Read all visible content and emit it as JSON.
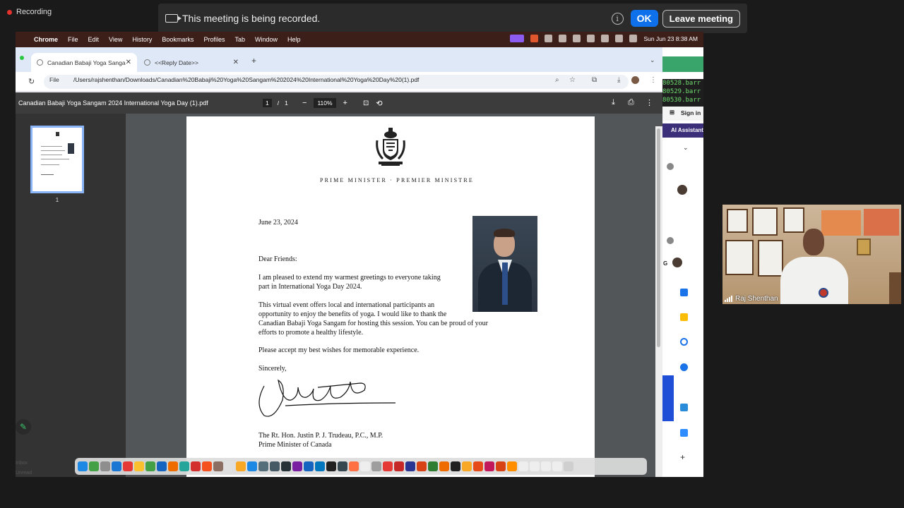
{
  "zoom": {
    "recording_label": "Recording",
    "banner_text": "This meeting is being recorded.",
    "ok_label": "OK",
    "leave_label": "Leave meeting",
    "participant_name": "Raj Shenthan"
  },
  "mac_menubar": {
    "app": "Chrome",
    "items": [
      "File",
      "Edit",
      "View",
      "History",
      "Bookmarks",
      "Profiles",
      "Tab",
      "Window",
      "Help"
    ],
    "clock": "Sun Jun 23  8:38 AM"
  },
  "browser": {
    "tabs": [
      {
        "label": "Canadian Babaji Yoga Sanga"
      },
      {
        "label": "<<Reply Date>>"
      }
    ],
    "url_scheme": "File",
    "url": "/Users/rajshenthan/Downloads/Canadian%20Babaji%20Yoga%20Sangam%202024%20International%20Yoga%20Day%20(1).pdf"
  },
  "pdf_viewer": {
    "title": "Canadian Babaji Yoga Sangam 2024 International Yoga Day (1).pdf",
    "page_current": "1",
    "page_sep": "/",
    "page_total": "1",
    "zoom": "110%",
    "thumb_page": "1"
  },
  "letter": {
    "office": "PRIME MINISTER · PREMIER MINISTRE",
    "date": "June 23, 2024",
    "salutation": "Dear Friends:",
    "p1_l1": "I am pleased to extend my warmest greetings to everyone taking",
    "p1_l2": "part in International Yoga Day 2024.",
    "p2_l1": "This virtual event offers local and international participants an",
    "p2_l2": "opportunity to enjoy the benefits of yoga. I would like to thank the",
    "p2_l3": "Canadian Babaji Yoga Sangam for hosting this session. You can be proud of your",
    "p2_l4": "efforts to promote a healthy lifestyle.",
    "p3": "Please accept my best wishes for memorable experience.",
    "closing": "Sincerely,",
    "name_line": "The Rt. Hon. Justin P. J. Trudeau, P.C., M.P.",
    "title_line": "Prime Minister of Canada"
  },
  "right_panel": {
    "terminal_lines": [
      "80528.barr",
      "80529.barr",
      "80530.barr"
    ],
    "sign_in": "Sign in",
    "ai_assistant": "AI Assistant",
    "side_letter": "G"
  },
  "left_strip": {
    "labels": [
      "Inbox",
      "Unread"
    ]
  }
}
